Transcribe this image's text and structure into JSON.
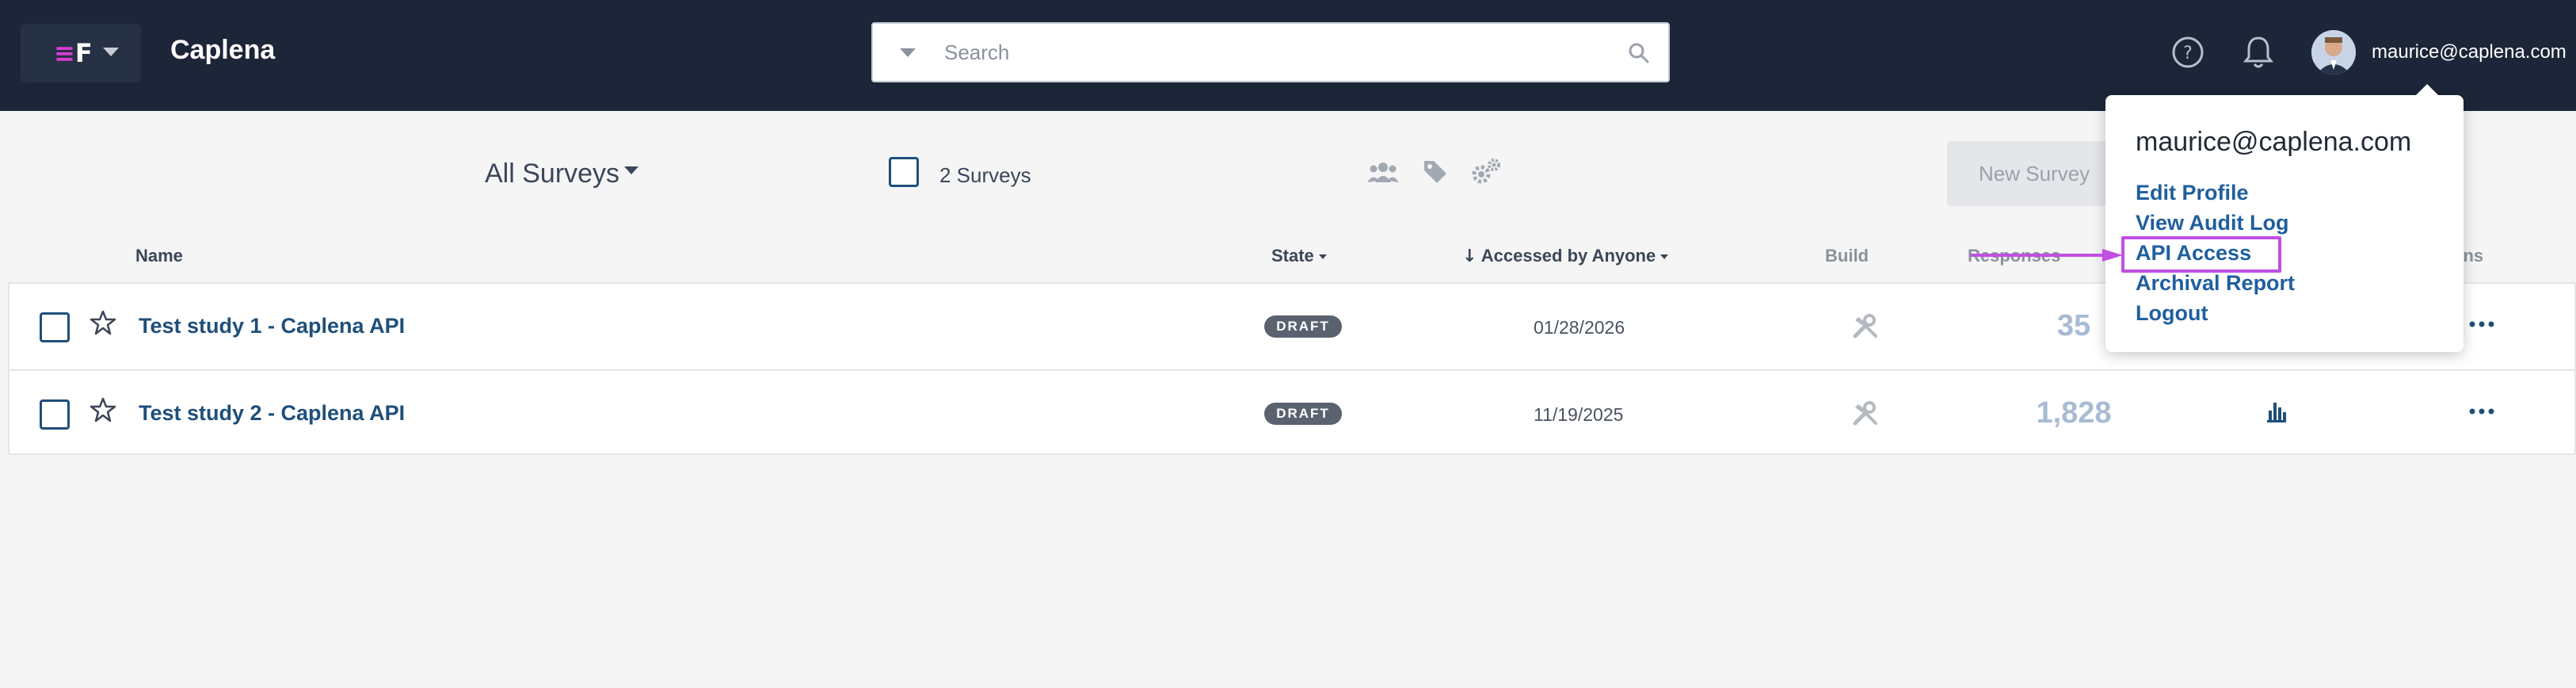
{
  "header": {
    "app_name": "Caplena",
    "search_placeholder": "Search",
    "user_email": "maurice@caplena.com"
  },
  "toolbar": {
    "filter_label": "All Surveys",
    "selection_count_label": "2 Surveys",
    "new_survey_label": "New Survey"
  },
  "columns": {
    "name": "Name",
    "state": "State",
    "accessed": "Accessed by Anyone",
    "build": "Build",
    "responses": "Responses",
    "actions": "ons"
  },
  "rows": [
    {
      "name": "Test study 1 - Caplena API",
      "state": "DRAFT",
      "accessed": "01/28/2026",
      "responses": "35"
    },
    {
      "name": "Test study 2 - Caplena API",
      "state": "DRAFT",
      "accessed": "11/19/2025",
      "responses": "1,828"
    }
  ],
  "user_menu": {
    "email": "maurice@caplena.com",
    "items": [
      "Edit Profile",
      "View Audit Log",
      "API Access",
      "Archival Report",
      "Logout"
    ]
  },
  "colors": {
    "topbar": "#1c2638",
    "link": "#1f5f9e",
    "highlight": "#c14fe2",
    "logo_accent": "#d93bd6"
  }
}
